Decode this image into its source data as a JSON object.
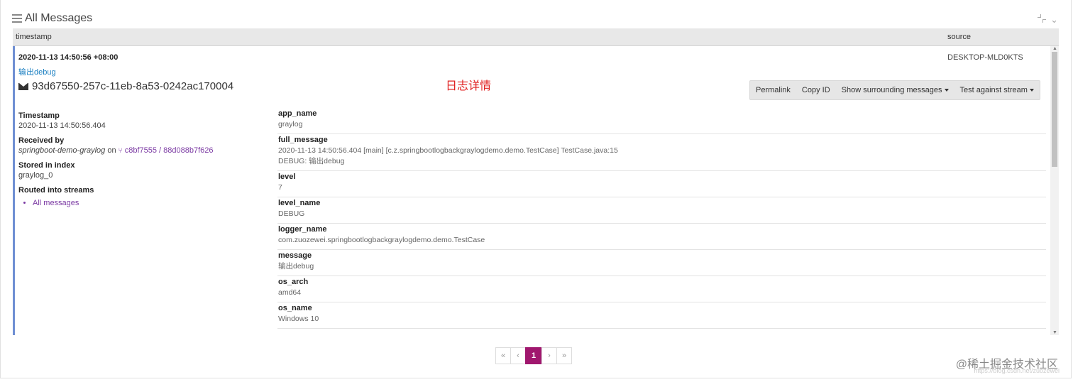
{
  "header": {
    "title": "All Messages"
  },
  "table": {
    "col_timestamp": "timestamp",
    "col_source": "source"
  },
  "message": {
    "timestamp": "2020-11-13 14:50:56 +08:00",
    "source": "DESKTOP-MLD0KTS",
    "text": "输出debug",
    "id": "93d67550-257c-11eb-8a53-0242ac170004",
    "annotation": "日志详情"
  },
  "actions": {
    "permalink": "Permalink",
    "copy_id": "Copy ID",
    "surrounding": "Show surrounding messages",
    "test_stream": "Test against stream"
  },
  "meta": {
    "timestamp_label": "Timestamp",
    "timestamp_value": "2020-11-13 14:50:56.404",
    "received_label": "Received by",
    "received_node": "springboot-demo-graylog",
    "received_on": "on",
    "received_input": "c8bf7555 / 88d088b7f626",
    "index_label": "Stored in index",
    "index_value": "graylog_0",
    "streams_label": "Routed into streams",
    "streams": [
      "All messages"
    ]
  },
  "fields": [
    {
      "key": "app_name",
      "value": "graylog"
    },
    {
      "key": "full_message",
      "value": "2020-11-13 14:50:56.404 [main] [c.z.springbootlogbackgraylogdemo.demo.TestCase] TestCase.java:15",
      "value2": "DEBUG: 输出debug"
    },
    {
      "key": "level",
      "value": "7"
    },
    {
      "key": "level_name",
      "value": "DEBUG"
    },
    {
      "key": "logger_name",
      "value": "com.zuozewei.springbootlogbackgraylogdemo.demo.TestCase"
    },
    {
      "key": "message",
      "value": "输出debug"
    },
    {
      "key": "os_arch",
      "value": "amd64"
    },
    {
      "key": "os_name",
      "value": "Windows 10"
    }
  ],
  "pagination": {
    "first": "«",
    "prev": "‹",
    "current": "1",
    "next": "›",
    "last": "»"
  },
  "watermark": "@稀土掘金技术社区",
  "watermark_url": "https://blog.csdn.net/zuozewei"
}
